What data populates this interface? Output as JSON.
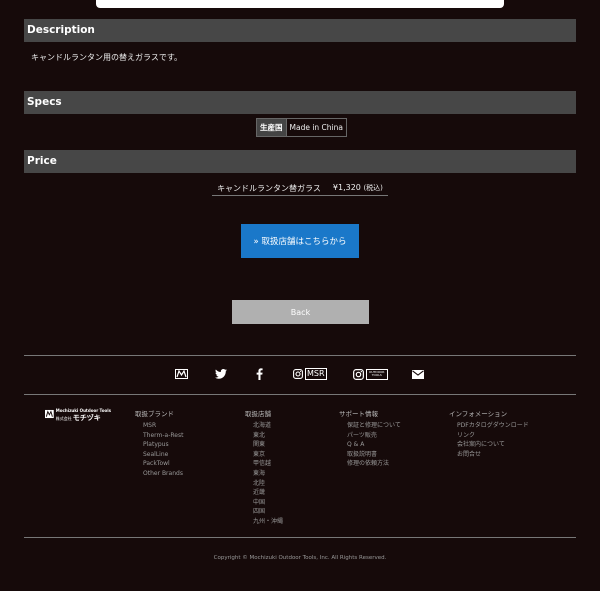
{
  "description": {
    "header": "Description",
    "text": "キャンドルランタン用の替えガラスです。"
  },
  "specs": {
    "header": "Specs",
    "rows": [
      {
        "key": "生産国",
        "value": "Made in China"
      }
    ]
  },
  "price": {
    "header": "Price",
    "product": "キャンドルランタン替ガラス",
    "amount": "¥1,320",
    "tax_note": "(税込)"
  },
  "buttons": {
    "stores": "» 取扱店舗はこちらから",
    "back": "Back"
  },
  "social": {
    "msr_label": "MSR",
    "outdoor_label_1": "OUTDOOR",
    "outdoor_label_2": "TOOLS"
  },
  "footer": {
    "logo_line1": "Mochizuki Outdoor Tools",
    "logo_line2_small": "株式会社",
    "logo_line2_big": "モチヅキ",
    "columns": [
      {
        "title": "取扱ブランド",
        "items": [
          "MSR",
          "Therm-a-Rest",
          "Platypus",
          "SealLine",
          "PackTowl",
          "Other Brands"
        ]
      },
      {
        "title": "取扱店舗",
        "items": [
          "北海道",
          "東北",
          "関東",
          "東京",
          "甲信越",
          "東海",
          "北陸",
          "近畿",
          "中国",
          "四国",
          "九州・沖縄"
        ]
      },
      {
        "title": "サポート情報",
        "items": [
          "保証と修理について",
          "パーツ販売",
          "Q & A",
          "取扱説明書",
          "修理の依頼方法"
        ]
      },
      {
        "title": "インフォメーション",
        "items": [
          "PDFカタログダウンロード",
          "リンク",
          "会社案内について",
          "お問合せ"
        ]
      }
    ],
    "copyright": "Copyright © Mochizuki Outdoor Tools, Inc. All Rights Reserved."
  }
}
